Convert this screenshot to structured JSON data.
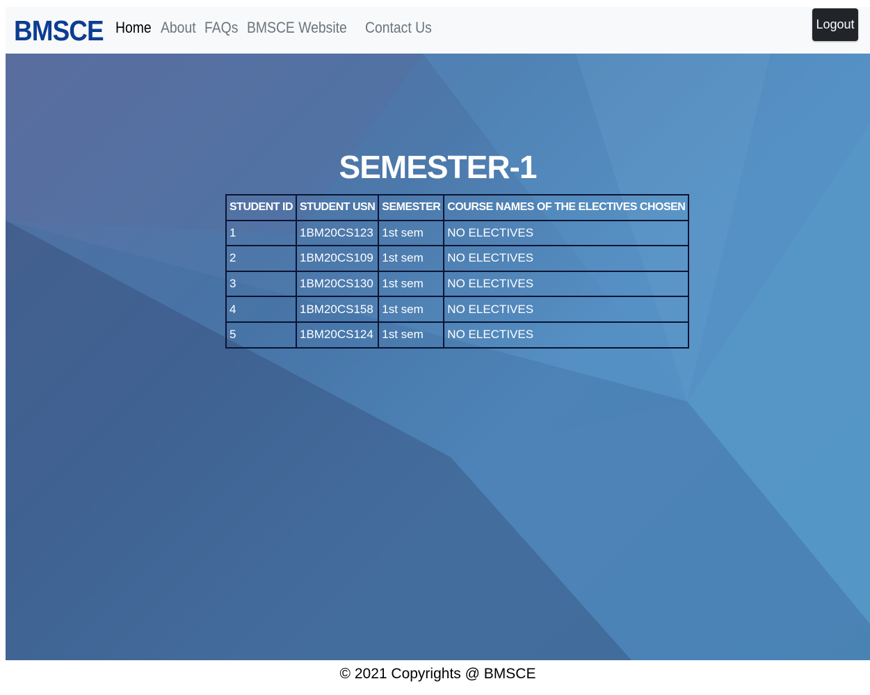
{
  "navbar": {
    "brand": "BMSCE",
    "links": [
      "Home",
      "About",
      "FAQs",
      "BMSCE Website",
      "Contact Us"
    ],
    "logout_label": "Logout"
  },
  "main": {
    "title": "SEMESTER-1",
    "table": {
      "headers": [
        "STUDENT ID",
        "STUDENT USN",
        "SEMESTER",
        "COURSE NAMES OF THE ELECTIVES CHOSEN"
      ],
      "rows": [
        [
          "1",
          "1BM20CS123",
          "1st sem",
          "NO ELECTIVES"
        ],
        [
          "2",
          "1BM20CS109",
          "1st sem",
          "NO ELECTIVES"
        ],
        [
          "3",
          "1BM20CS130",
          "1st sem",
          "NO ELECTIVES"
        ],
        [
          "4",
          "1BM20CS158",
          "1st sem",
          "NO ELECTIVES"
        ],
        [
          "5",
          "1BM20CS124",
          "1st sem",
          "NO ELECTIVES"
        ]
      ]
    }
  },
  "footer": {
    "text": "© 2021 Copyrights @ BMSCE"
  },
  "colors": {
    "brand": "#0b3d91",
    "logout_bg": "#212529",
    "table_border": "#0a1433"
  }
}
